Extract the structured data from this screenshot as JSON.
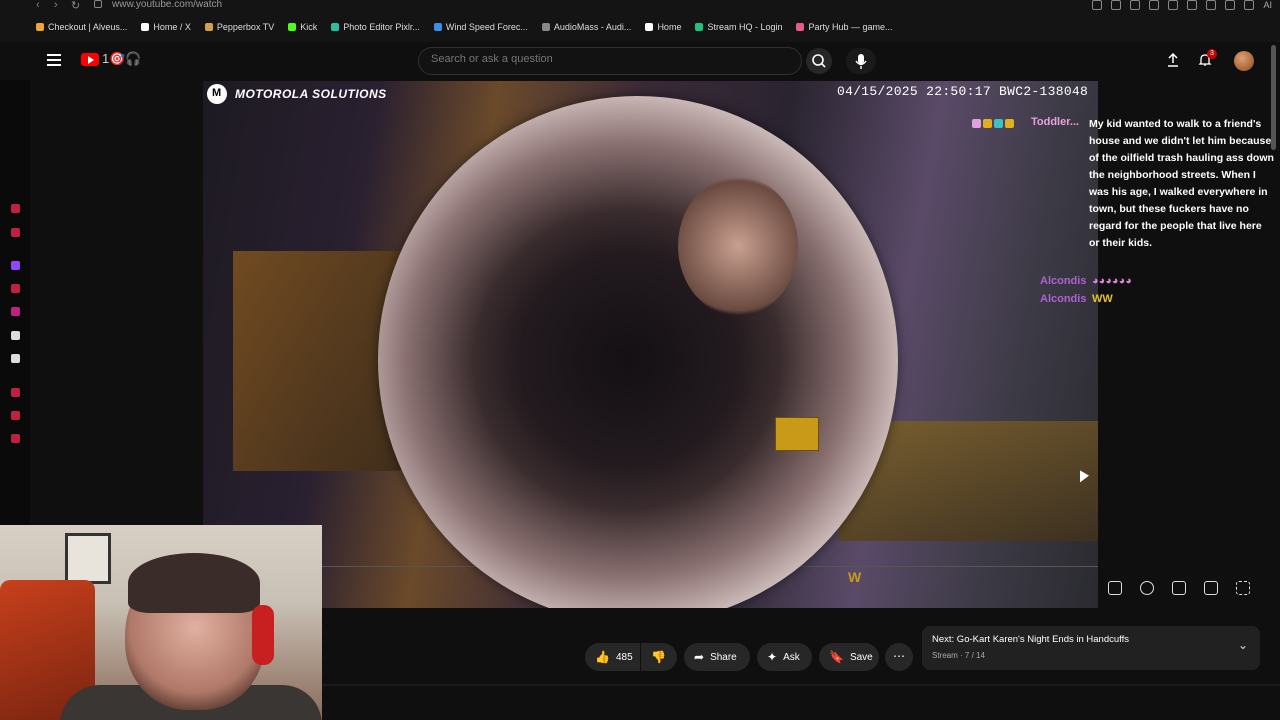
{
  "browser": {
    "url": "www.youtube.com/watch",
    "bookmarks": [
      {
        "label": "Checkout | Alveus...",
        "color": "#f2a33a"
      },
      {
        "label": "Home / X",
        "color": "#ffffff"
      },
      {
        "label": "Pepperbox TV",
        "color": "#d4a050"
      },
      {
        "label": "Kick",
        "color": "#53fc18"
      },
      {
        "label": "Photo Editor Pixlr...",
        "color": "#2ac0a0"
      },
      {
        "label": "Wind Speed Forec...",
        "color": "#3a8ee8"
      },
      {
        "label": "AudioMass - Audi...",
        "color": "#888888"
      },
      {
        "label": "Home",
        "color": "#ffffff"
      },
      {
        "label": "Stream HQ - Login",
        "color": "#20c080"
      },
      {
        "label": "Party Hub — game...",
        "color": "#e85a8a"
      }
    ],
    "ai_label": "AI"
  },
  "youtube": {
    "logo_suffix": "1🎯🎧",
    "search_placeholder": "Search or ask a question",
    "notification_count": "3"
  },
  "video": {
    "brand": "MOTOROLA SOLUTIONS",
    "timestamp": "04/15/2025 22:50:17   BWC2-138048",
    "overlay_w": "W",
    "chat": {
      "user1": "Toddler...",
      "message1": "My kid wanted to walk to a friend's house and we didn't let him because of the oilfield trash hauling ass down the neighborhood streets. When I was his age, I walked everywhere in town, but these fuckers have no regard for the people that live here or their kids.",
      "user2": "Alcondis",
      "message2": "◕◕◕◕◕◕",
      "user3": "Alcondis",
      "message3": "WW"
    }
  },
  "actions": {
    "like_count": "485",
    "share_label": "Share",
    "ask_label": "Ask",
    "save_label": "Save"
  },
  "next_up": {
    "title": "Next: Go-Kart Karen's Night Ends in Handcuffs",
    "subtitle": "Stream · 7 / 14"
  }
}
